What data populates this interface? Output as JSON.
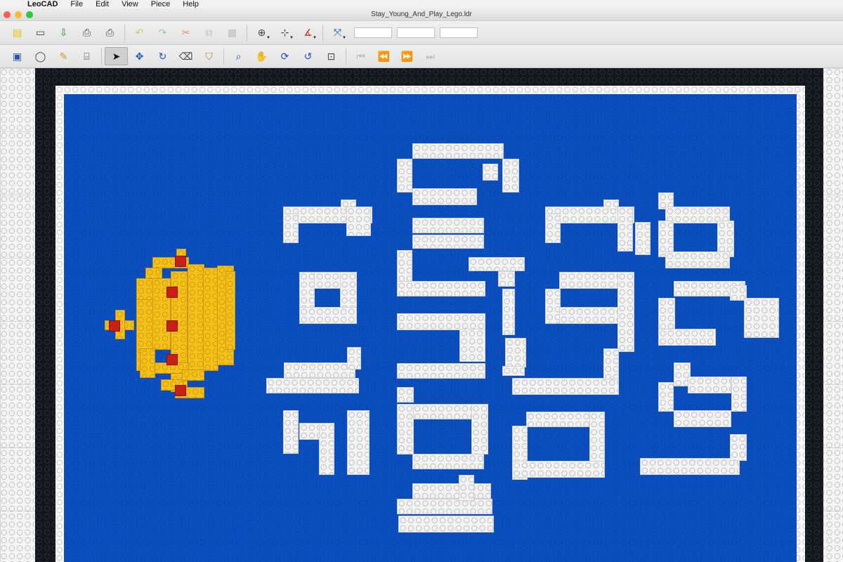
{
  "menubar": {
    "apple": "",
    "app_name": "LeoCAD",
    "items": [
      "File",
      "Edit",
      "View",
      "Piece",
      "Help"
    ]
  },
  "window": {
    "title": "Stay_Young_And_Play_Lego.ldr",
    "traffic_colors": [
      "#fd5f57",
      "#febc2e",
      "#28c840"
    ]
  },
  "toolbar1": {
    "buttons": [
      {
        "name": "new-icon",
        "glyph": "🗋"
      },
      {
        "name": "open-icon",
        "glyph": "📂"
      },
      {
        "name": "save-icon",
        "glyph": "⇩"
      },
      {
        "name": "print-icon",
        "glyph": "⎙"
      },
      {
        "name": "print-preview-icon",
        "glyph": "⎙"
      },
      {
        "name": "undo-icon",
        "glyph": "↶"
      },
      {
        "name": "redo-icon",
        "glyph": "↷"
      },
      {
        "name": "cut-icon",
        "glyph": "✂"
      },
      {
        "name": "copy-icon",
        "glyph": "⧉"
      },
      {
        "name": "paste-icon",
        "glyph": "📋"
      },
      {
        "name": "snap-xy-icon",
        "glyph": "⊕"
      },
      {
        "name": "snap-z-icon",
        "glyph": "⊹"
      },
      {
        "name": "snap-angle-icon",
        "glyph": "∡"
      },
      {
        "name": "transform-icon",
        "glyph": "⤧"
      }
    ],
    "fields": [
      "",
      "",
      ""
    ]
  },
  "toolbar2": {
    "buttons": [
      {
        "name": "insert-piece-icon",
        "glyph": "▣"
      },
      {
        "name": "light-icon",
        "glyph": "💡"
      },
      {
        "name": "spotlight-icon",
        "glyph": "✎"
      },
      {
        "name": "camera-icon",
        "glyph": "🎥"
      },
      {
        "name": "select-icon",
        "glyph": "➤"
      },
      {
        "name": "move-icon",
        "glyph": "✥"
      },
      {
        "name": "rotate-icon",
        "glyph": "↻"
      },
      {
        "name": "eraser-icon",
        "glyph": "⌫"
      },
      {
        "name": "paint-icon",
        "glyph": "🪣"
      },
      {
        "name": "zoom-icon",
        "glyph": "🔍"
      },
      {
        "name": "pan-icon",
        "glyph": "✋"
      },
      {
        "name": "rotate-view-icon",
        "glyph": "⟳"
      },
      {
        "name": "roll-icon",
        "glyph": "↺"
      },
      {
        "name": "zoom-region-icon",
        "glyph": "⊡"
      },
      {
        "name": "first-step-icon",
        "glyph": "⏮"
      },
      {
        "name": "previous-step-icon",
        "glyph": "⏪"
      },
      {
        "name": "next-step-icon",
        "glyph": "⏩"
      },
      {
        "name": "last-step-icon",
        "glyph": "⏭"
      }
    ]
  },
  "colors": {
    "baseplate_blue": "#0a4fbf",
    "brick_white": "#f3f3f3",
    "brick_yellow": "#f2c21b",
    "brick_red": "#c62014",
    "frame_black": "#13171c"
  }
}
